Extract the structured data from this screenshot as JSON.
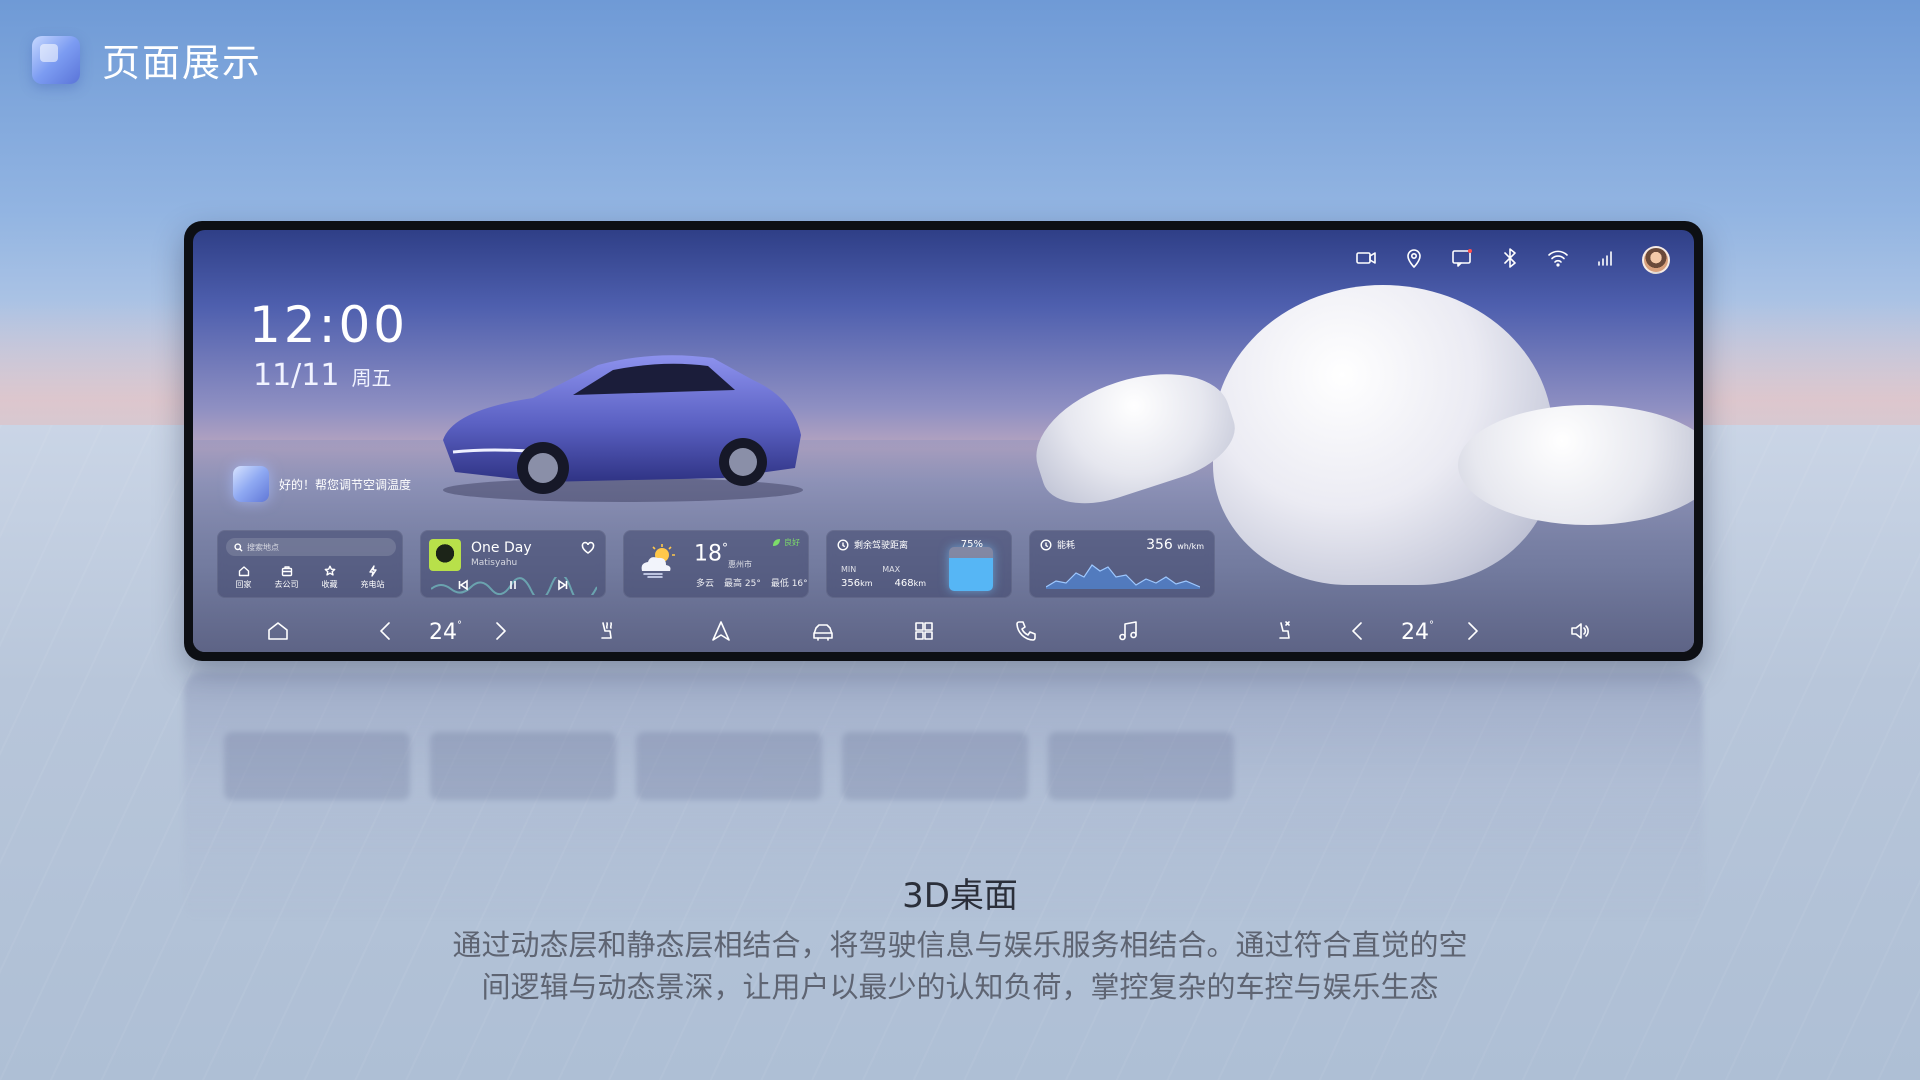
{
  "header": {
    "title": "页面展示"
  },
  "screen": {
    "clock": "12:00",
    "date": "11/11",
    "weekday": "周五",
    "assistant_text": "好的！帮您调节空调温度",
    "nav_widget": {
      "search_placeholder": "搜索地点",
      "items": [
        {
          "label": "回家",
          "icon": "home-icon"
        },
        {
          "label": "去公司",
          "icon": "briefcase-icon"
        },
        {
          "label": "收藏",
          "icon": "star-icon"
        },
        {
          "label": "充电站",
          "icon": "lightning-icon"
        }
      ]
    },
    "music_widget": {
      "song": "One Day",
      "artist": "Matisyahu"
    },
    "weather_widget": {
      "temp": "18",
      "unit": "°",
      "city": "惠州市",
      "air_quality": "良好",
      "condition": "多云",
      "high": "最高 25°",
      "low": "最低 16°"
    },
    "range_widget": {
      "title": "剩余驾驶距离",
      "min_label": "MIN",
      "max_label": "MAX",
      "min_value": "356",
      "max_value": "468",
      "unit": "km",
      "battery": "75%"
    },
    "energy_widget": {
      "title": "能耗",
      "value": "356",
      "unit": "wh/km"
    },
    "dock": {
      "left_temp": "24",
      "right_temp": "24",
      "degree": "°"
    }
  },
  "caption": {
    "title": "3D桌面",
    "body_line1": "通过动态层和静态层相结合，将驾驶信息与娱乐服务相结合。通过符合直觉的空",
    "body_line2": "间逻辑与动态景深，让用户以最少的认知负荷，掌控复杂的车控与娱乐生态"
  },
  "colors": {
    "accent": "#5a74d8",
    "eco": "#7ddc6a",
    "battery": "#56b6f5"
  }
}
